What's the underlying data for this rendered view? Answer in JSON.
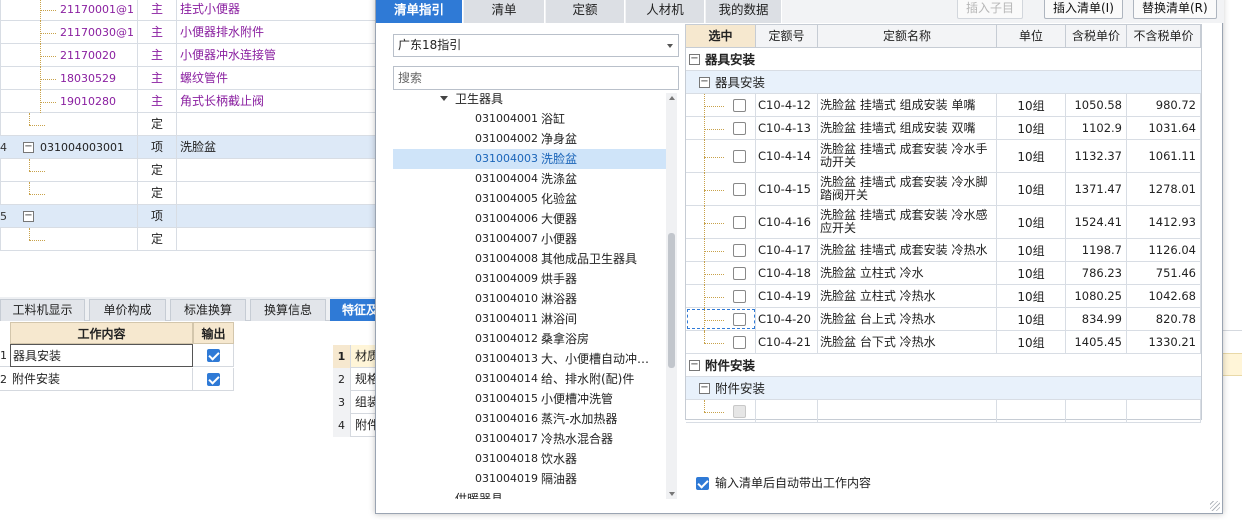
{
  "background_rows": [
    {
      "num": "",
      "code": "21170001@1",
      "type": "主",
      "name": "挂式小便器",
      "level": 2
    },
    {
      "num": "",
      "code": "21170030@1",
      "type": "主",
      "name": "小便器排水附件",
      "level": 2
    },
    {
      "num": "",
      "code": "21170020",
      "type": "主",
      "name": "小便器冲水连接管",
      "level": 2
    },
    {
      "num": "",
      "code": "18030529",
      "type": "主",
      "name": "螺纹管件",
      "level": 2
    },
    {
      "num": "",
      "code": "19010280",
      "type": "主",
      "name": "角式长柄截止阀",
      "level": 2
    },
    {
      "num": "",
      "code": "",
      "type": "定",
      "name": "",
      "level": 1
    },
    {
      "num": "4",
      "code": "031004003001",
      "type": "项",
      "name": "洗脸盆",
      "level": 0,
      "selected": true
    },
    {
      "num": "",
      "code": "",
      "type": "定",
      "name": "",
      "level": 1
    },
    {
      "num": "",
      "code": "",
      "type": "定",
      "name": "",
      "level": 1
    },
    {
      "num": "5",
      "code": "",
      "type": "项",
      "name": "",
      "level": 0,
      "selected": true
    },
    {
      "num": "",
      "code": "",
      "type": "定",
      "name": "",
      "level": 1
    }
  ],
  "bottom_tabs": [
    "工料机显示",
    "单价构成",
    "标准换算",
    "换算信息",
    "特征及"
  ],
  "work_content": {
    "header_content": "工作内容",
    "header_output": "输出",
    "rows": [
      {
        "num": "1",
        "text": "器具安装",
        "checked": true
      },
      {
        "num": "2",
        "text": "附件安装",
        "checked": true
      }
    ]
  },
  "attr_rows": [
    {
      "num": "1",
      "text": "材质"
    },
    {
      "num": "2",
      "text": "规格"
    },
    {
      "num": "3",
      "text": "组装"
    },
    {
      "num": "4",
      "text": "附件"
    }
  ],
  "dialog": {
    "tabs": [
      "清单指引",
      "清单",
      "定额",
      "人材机",
      "我的数据"
    ],
    "buttons": {
      "insert_child": "插入子目",
      "insert_list": "插入清单(I)",
      "replace_list": "替换清单(R)"
    },
    "guide_select": "广东18指引",
    "search_placeholder": "搜索",
    "tree": {
      "parent": "卫生器具",
      "items": [
        {
          "code": "031004001",
          "name": "浴缸"
        },
        {
          "code": "031004002",
          "name": "净身盆"
        },
        {
          "code": "031004003",
          "name": "洗脸盆",
          "selected": true
        },
        {
          "code": "031004004",
          "name": "洗涤盆"
        },
        {
          "code": "031004005",
          "name": "化验盆"
        },
        {
          "code": "031004006",
          "name": "大便器"
        },
        {
          "code": "031004007",
          "name": "小便器"
        },
        {
          "code": "031004008",
          "name": "其他成品卫生器具"
        },
        {
          "code": "031004009",
          "name": "烘手器"
        },
        {
          "code": "031004010",
          "name": "淋浴器"
        },
        {
          "code": "031004011",
          "name": "淋浴间"
        },
        {
          "code": "031004012",
          "name": "桑拿浴房"
        },
        {
          "code": "031004013",
          "name": "大、小便槽自动冲…"
        },
        {
          "code": "031004014",
          "name": "给、排水附(配)件"
        },
        {
          "code": "031004015",
          "name": "小便槽冲洗管"
        },
        {
          "code": "031004016",
          "name": "蒸汽-水加热器"
        },
        {
          "code": "031004017",
          "name": "冷热水混合器"
        },
        {
          "code": "031004018",
          "name": "饮水器"
        },
        {
          "code": "031004019",
          "name": "隔油器"
        }
      ],
      "next_parent": "供暖器具"
    },
    "grid": {
      "headers": [
        "选中",
        "定额号",
        "定额名称",
        "单位",
        "含税单价",
        "不含税单价"
      ],
      "group1": "器具安装",
      "group1_sub": "器具安装",
      "rows": [
        {
          "code": "C10-4-12",
          "name": "洗脸盆 挂墙式 组成安装 单嘴",
          "unit": "10组",
          "tax": "1050.58",
          "notax": "980.72"
        },
        {
          "code": "C10-4-13",
          "name": "洗脸盆 挂墙式 组成安装 双嘴",
          "unit": "10组",
          "tax": "1102.9",
          "notax": "1031.64"
        },
        {
          "code": "C10-4-14",
          "name": "洗脸盆 挂墙式 成套安装 冷水手动开关",
          "unit": "10组",
          "tax": "1132.37",
          "notax": "1061.11"
        },
        {
          "code": "C10-4-15",
          "name": "洗脸盆 挂墙式 成套安装 冷水脚踏阀开关",
          "unit": "10组",
          "tax": "1371.47",
          "notax": "1278.01"
        },
        {
          "code": "C10-4-16",
          "name": "洗脸盆 挂墙式 成套安装 冷水感应开关",
          "unit": "10组",
          "tax": "1524.41",
          "notax": "1412.93"
        },
        {
          "code": "C10-4-17",
          "name": "洗脸盆 挂墙式 成套安装 冷热水",
          "unit": "10组",
          "tax": "1198.7",
          "notax": "1126.04"
        },
        {
          "code": "C10-4-18",
          "name": "洗脸盆 立柱式 冷水",
          "unit": "10组",
          "tax": "786.23",
          "notax": "751.46"
        },
        {
          "code": "C10-4-19",
          "name": "洗脸盆 立柱式 冷热水",
          "unit": "10组",
          "tax": "1080.25",
          "notax": "1042.68"
        },
        {
          "code": "C10-4-20",
          "name": "洗脸盆 台上式 冷热水",
          "unit": "10组",
          "tax": "834.99",
          "notax": "820.78"
        },
        {
          "code": "C10-4-21",
          "name": "洗脸盆 台下式 冷热水",
          "unit": "10组",
          "tax": "1405.45",
          "notax": "1330.21"
        }
      ],
      "group2": "附件安装",
      "group2_sub": "附件安装"
    },
    "auto_bring_label": "输入清单后自动带出工作内容",
    "auto_bring_checked": true
  }
}
